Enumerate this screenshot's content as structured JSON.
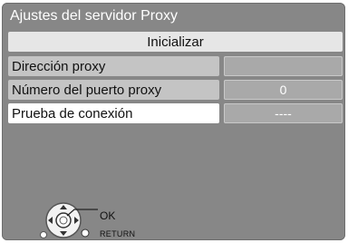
{
  "title": "Ajustes del servidor Proxy",
  "init_button": "Inicializar",
  "rows": [
    {
      "label": "Dirección proxy",
      "value": ""
    },
    {
      "label": "Número del puerto proxy",
      "value": "0"
    },
    {
      "label": "Prueba de conexión",
      "value": "----"
    }
  ],
  "nav": {
    "ok_label": "OK",
    "return_label": "RETURN",
    "icon": "remote-dpad-icon"
  },
  "colors": {
    "background": "#878787",
    "selected_row": "#ffffff",
    "row": "#c4c4c4",
    "value_box": "#a9a9a9"
  }
}
